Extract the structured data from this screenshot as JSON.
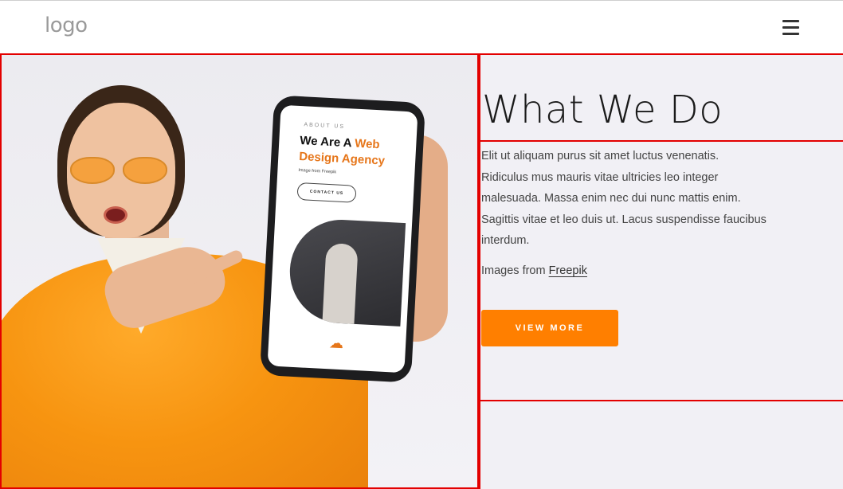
{
  "header": {
    "logo_text": "logo",
    "menu_icon": "hamburger-menu-icon"
  },
  "hero": {
    "image": {
      "phone": {
        "eyebrow": "ABOUT US",
        "heading_start": "We Are A ",
        "heading_accent": "Web Design Agency",
        "image_credit": "Image from Freepik",
        "button_label": "CONTACT US",
        "icon": "cloud-upload-icon"
      }
    },
    "title": "What We Do",
    "paragraph": "Elit ut aliquam purus sit amet luctus venenatis. Ridiculus mus mauris vitae ultricies leo integer malesuada. Massa enim nec dui nunc mattis enim. Sagittis vitae et leo duis ut. Lacus suspendisse faucibus interdum.",
    "credit_prefix": "Images from ",
    "credit_link": "Freepik",
    "button_label": "VIEW MORE"
  },
  "colors": {
    "accent": "#ff7f00",
    "outline": "#e30000",
    "background": "#f1f0f5"
  }
}
